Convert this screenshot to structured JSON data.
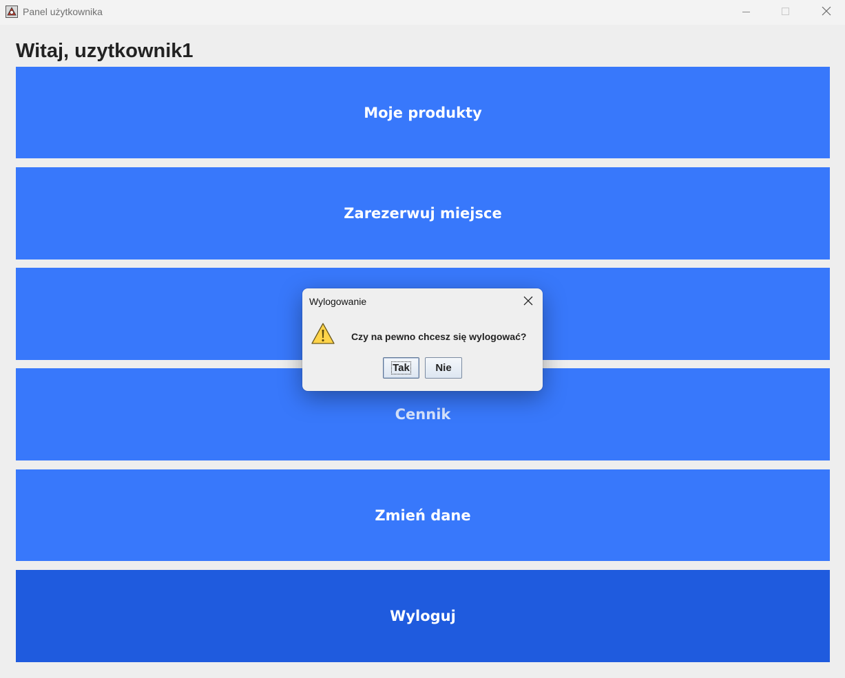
{
  "window": {
    "title": "Panel użytkownika",
    "icon": "java-app-icon",
    "controls": [
      "minimize-icon",
      "maximize-icon",
      "close-icon"
    ]
  },
  "main": {
    "greeting": "Witaj, uzytkownik1",
    "buttons": [
      {
        "label": "Moje produkty"
      },
      {
        "label": "Zarezerwuj miejsce"
      },
      {
        "label": ""
      },
      {
        "label": "Cennik"
      },
      {
        "label": "Zmień dane"
      },
      {
        "label": "Wyloguj"
      }
    ]
  },
  "dialog": {
    "title": "Wylogowanie",
    "message": "Czy na pewno chcesz się wylogować?",
    "icon": "warning-icon",
    "yes_label": "Tak",
    "no_label": "Nie"
  },
  "colors": {
    "button": "#3878fb",
    "button_active": "#1f5bde",
    "background": "#eeeeee"
  }
}
